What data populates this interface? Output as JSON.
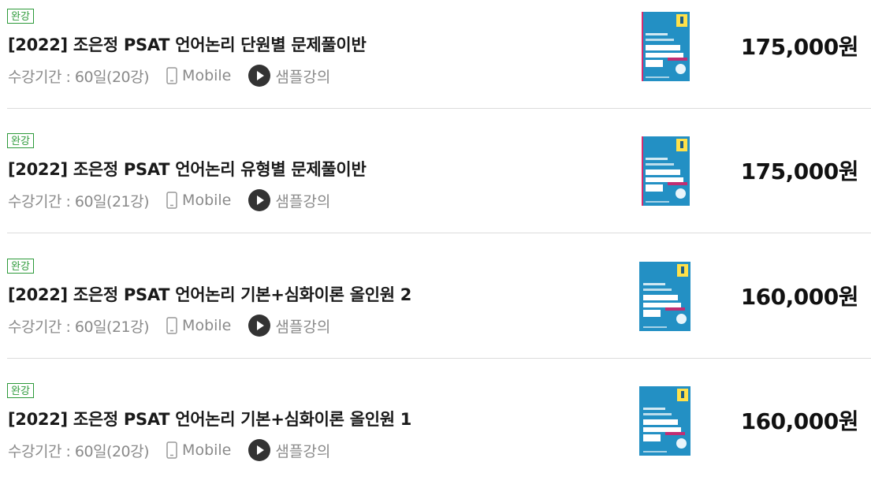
{
  "courses": [
    {
      "badge": "완강",
      "title": "[2022] 조은정 PSAT 언어논리 단원별 문제풀이반",
      "period": "수강기간 : 60일(20강)",
      "mobile_label": "Mobile",
      "sample_label": "샘플강의",
      "price": "175,000원"
    },
    {
      "badge": "완강",
      "title": "[2022] 조은정 PSAT 언어논리 유형별 문제풀이반",
      "period": "수강기간 : 60일(21강)",
      "mobile_label": "Mobile",
      "sample_label": "샘플강의",
      "price": "175,000원"
    },
    {
      "badge": "완강",
      "title": "[2022] 조은정 PSAT 언어논리 기본+심화이론 올인원 2",
      "period": "수강기간 : 60일(21강)",
      "mobile_label": "Mobile",
      "sample_label": "샘플강의",
      "price": "160,000원"
    },
    {
      "badge": "완강",
      "title": "[2022] 조은정 PSAT 언어논리 기본+심화이론 올인원 1",
      "period": "수강기간 : 60일(20강)",
      "mobile_label": "Mobile",
      "sample_label": "샘플강의",
      "price": "160,000원"
    }
  ],
  "icons": {
    "mobile": "mobile-phone-icon",
    "sample": "play-circle-icon"
  },
  "colors": {
    "badge": "#2d9a3a",
    "cover": "#2390c4",
    "meta_text": "#8a8a8a",
    "play_button": "#333333"
  }
}
